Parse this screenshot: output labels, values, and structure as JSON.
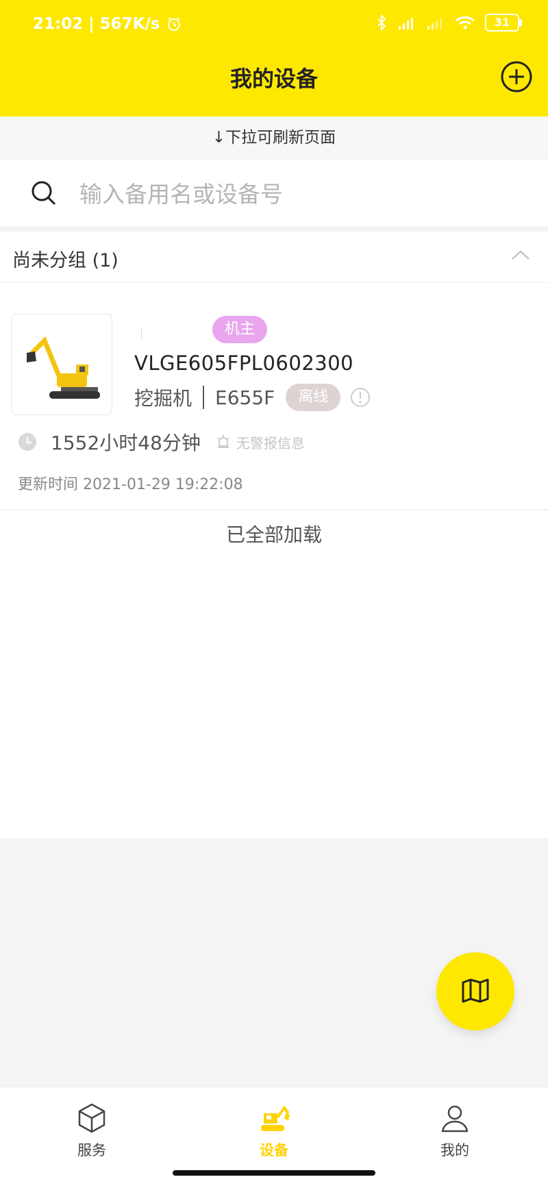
{
  "status_bar": {
    "time": "21:02",
    "speed": "567K/s",
    "battery": "31"
  },
  "header": {
    "title": "我的设备"
  },
  "pull_hint": "↓下拉可刷新页面",
  "search": {
    "placeholder": "输入备用名或设备号"
  },
  "group": {
    "title": "尚未分组 (1)"
  },
  "device": {
    "role": "机主",
    "id": "VLGE605FPL0602300",
    "type": "挖掘机",
    "model": "E655F",
    "status": "离线",
    "runtime": "1552小时48分钟",
    "alarm": "无警报信息",
    "update_label": "更新时间",
    "update_time": "2021-01-29 19:22:08"
  },
  "list_footer": "已全部加载",
  "tabbar": {
    "items": [
      {
        "label": "服务",
        "icon": "cube-icon"
      },
      {
        "label": "设备",
        "icon": "excavator-icon"
      },
      {
        "label": "我的",
        "icon": "user-icon"
      }
    ]
  },
  "colors": {
    "accent": "#ffe800",
    "badge": "#e9a6ef",
    "offline_tag": "#ddd3d3"
  }
}
